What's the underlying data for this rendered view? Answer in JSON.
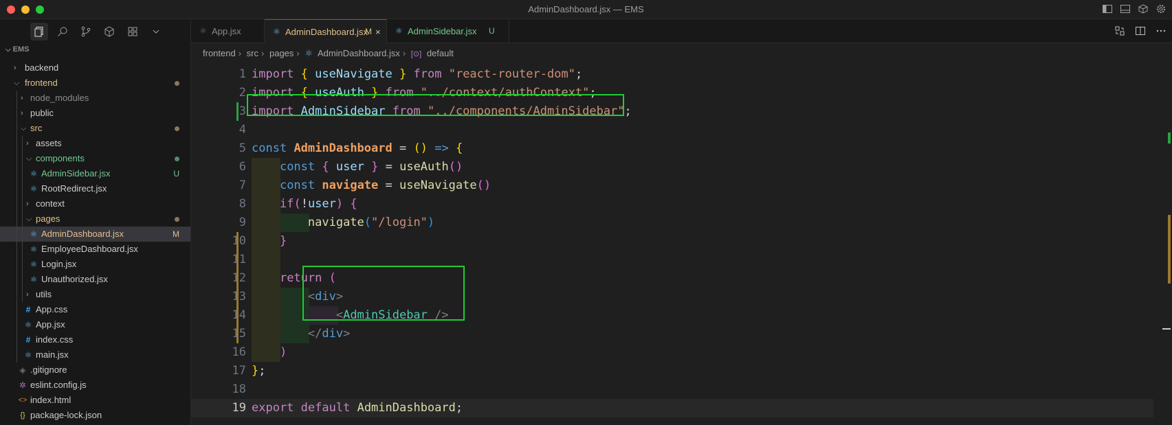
{
  "window": {
    "title": "AdminDashboard.jsx — EMS"
  },
  "explorer": {
    "workspace": "EMS",
    "items": [
      {
        "label": "backend",
        "kind": "folder"
      },
      {
        "label": "frontend",
        "kind": "folder"
      },
      {
        "label": "node_modules",
        "kind": "folder"
      },
      {
        "label": "public",
        "kind": "folder"
      },
      {
        "label": "src",
        "kind": "folder"
      },
      {
        "label": "assets",
        "kind": "folder"
      },
      {
        "label": "components",
        "kind": "folder"
      },
      {
        "label": "AdminSidebar.jsx",
        "kind": "jsx",
        "badge": "U"
      },
      {
        "label": "RootRedirect.jsx",
        "kind": "jsx"
      },
      {
        "label": "context",
        "kind": "folder"
      },
      {
        "label": "pages",
        "kind": "folder"
      },
      {
        "label": "AdminDashboard.jsx",
        "kind": "jsx",
        "badge": "M"
      },
      {
        "label": "EmployeeDashboard.jsx",
        "kind": "jsx"
      },
      {
        "label": "Login.jsx",
        "kind": "jsx"
      },
      {
        "label": "Unauthorized.jsx",
        "kind": "jsx"
      },
      {
        "label": "utils",
        "kind": "folder"
      },
      {
        "label": "App.css",
        "kind": "css"
      },
      {
        "label": "App.jsx",
        "kind": "jsx"
      },
      {
        "label": "index.css",
        "kind": "css"
      },
      {
        "label": "main.jsx",
        "kind": "jsx"
      },
      {
        "label": ".gitignore",
        "kind": "git"
      },
      {
        "label": "eslint.config.js",
        "kind": "eslint"
      },
      {
        "label": "index.html",
        "kind": "html"
      },
      {
        "label": "package-lock.json",
        "kind": "json"
      }
    ]
  },
  "tabs": [
    {
      "label": "App.jsx",
      "status": ""
    },
    {
      "label": "AdminDashboard.jsx",
      "status": "M",
      "close": "×"
    },
    {
      "label": "AdminSidebar.jsx",
      "status": "U"
    }
  ],
  "breadcrumb": [
    "frontend",
    "src",
    "pages",
    "AdminDashboard.jsx",
    "default"
  ],
  "editor": {
    "line_numbers": [
      "1",
      "2",
      "3",
      "4",
      "5",
      "6",
      "7",
      "8",
      "9",
      "10",
      "11",
      "12",
      "13",
      "14",
      "15",
      "16",
      "17",
      "18",
      "19"
    ],
    "current_line": 19
  },
  "colors": {
    "accent": "#0078d4",
    "modified": "#e2c08d",
    "untracked": "#73c991",
    "highlight_box": "#22cc33"
  }
}
